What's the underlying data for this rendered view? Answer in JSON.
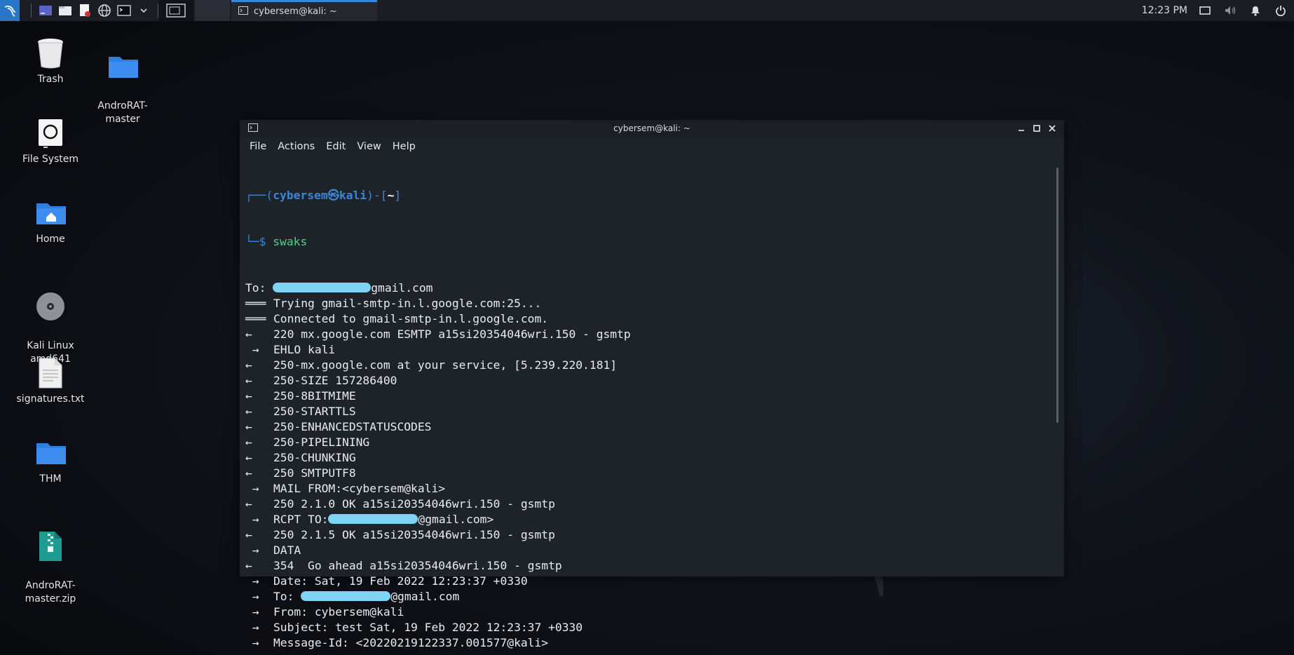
{
  "panel": {
    "window_task_title": "cybersem@kali: ~",
    "clock": "12:23 PM",
    "icons": [
      "kali-menu-icon",
      "show-desktop-icon",
      "file-manager-icon",
      "text-editor-icon",
      "web-browser-icon",
      "terminal-icon",
      "chevron-down-icon",
      "workspace-1-icon",
      "display-icon",
      "volume-icon",
      "notification-icon",
      "power-icon"
    ]
  },
  "desktop_icons": [
    {
      "label": "Trash",
      "icon": "trash-icon"
    },
    {
      "label": "AndroRAT-\nmaster",
      "icon": "folder-icon"
    },
    {
      "label": "File System",
      "icon": "drive-icon"
    },
    {
      "label": "Home",
      "icon": "home-folder-icon"
    },
    {
      "label": "Kali Linux\namd641",
      "icon": "disc-icon"
    },
    {
      "label": "signatures.txt",
      "icon": "text-file-icon"
    },
    {
      "label": "THM",
      "icon": "folder-icon"
    },
    {
      "label": "AndroRAT-\nmaster.zip",
      "icon": "zip-file-icon"
    }
  ],
  "terminal": {
    "title": "cybersem@kali: ~",
    "menu": [
      "File",
      "Actions",
      "Edit",
      "View",
      "Help"
    ],
    "prompt": {
      "open": "┌──(",
      "user": "cybersem㉿kali",
      "close": ")-[",
      "path": "~",
      "end": "]",
      "dollar": "└─$ ",
      "command": "swaks"
    },
    "lines": [
      {
        "prefix": "",
        "text_before": "To: ",
        "redacted": true,
        "text_after": "gmail.com"
      },
      {
        "prefix": "===",
        "text": "Trying gmail-smtp-in.l.google.com:25..."
      },
      {
        "prefix": "===",
        "text": "Connected to gmail-smtp-in.l.google.com."
      },
      {
        "prefix": "<-",
        "text": "220 mx.google.com ESMTP a15si20354046wri.150 - gsmtp"
      },
      {
        "prefix": " ->",
        "text": "EHLO kali"
      },
      {
        "prefix": "<-",
        "text": "250-mx.google.com at your service, [5.239.220.181]"
      },
      {
        "prefix": "<-",
        "text": "250-SIZE 157286400"
      },
      {
        "prefix": "<-",
        "text": "250-8BITMIME"
      },
      {
        "prefix": "<-",
        "text": "250-STARTTLS"
      },
      {
        "prefix": "<-",
        "text": "250-ENHANCEDSTATUSCODES"
      },
      {
        "prefix": "<-",
        "text": "250-PIPELINING"
      },
      {
        "prefix": "<-",
        "text": "250-CHUNKING"
      },
      {
        "prefix": "<-",
        "text": "250 SMTPUTF8"
      },
      {
        "prefix": " ->",
        "text": "MAIL FROM:<cybersem@kali>"
      },
      {
        "prefix": "<-",
        "text": "250 2.1.0 OK a15si20354046wri.150 - gsmtp"
      },
      {
        "prefix": " ->",
        "text_before": "RCPT TO:",
        "redacted": true,
        "text_after": "@gmail.com>"
      },
      {
        "prefix": "<-",
        "text": "250 2.1.5 OK a15si20354046wri.150 - gsmtp"
      },
      {
        "prefix": " ->",
        "text": "DATA"
      },
      {
        "prefix": "<-",
        "text": "354  Go ahead a15si20354046wri.150 - gsmtp"
      },
      {
        "prefix": " ->",
        "text": "Date: Sat, 19 Feb 2022 12:23:37 +0330"
      },
      {
        "prefix": " ->",
        "text_before": "To: ",
        "redacted": true,
        "text_after": "@gmail.com"
      },
      {
        "prefix": " ->",
        "text": "From: cybersem@kali"
      },
      {
        "prefix": " ->",
        "text": "Subject: test Sat, 19 Feb 2022 12:23:37 +0330"
      },
      {
        "prefix": " ->",
        "text": "Message-Id: <20220219122337.001577@kali>"
      }
    ]
  },
  "colors": {
    "accent": "#3b87d6",
    "command": "#4fd18b",
    "terminal_bg": "#1e2229",
    "redaction": "#7fd3f5"
  }
}
